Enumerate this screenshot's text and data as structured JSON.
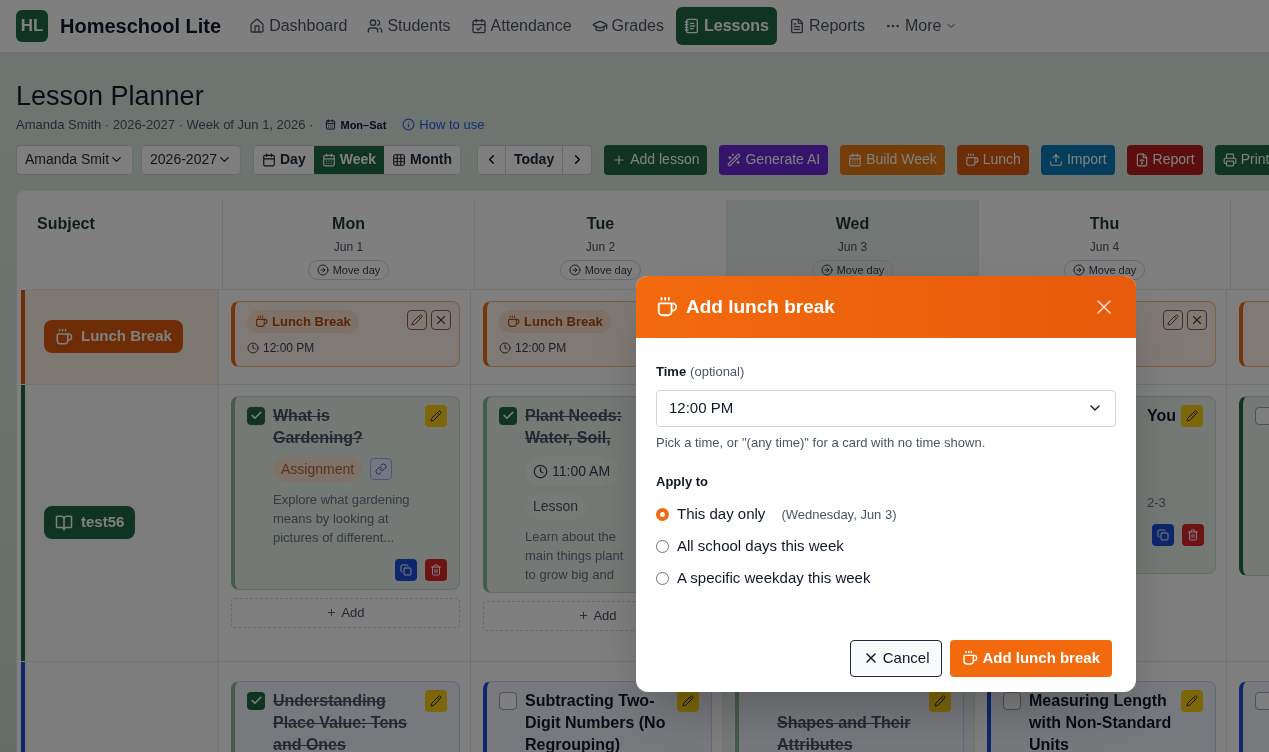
{
  "nav": {
    "logo": "HL",
    "brand": "Homeschool Lite",
    "items": [
      {
        "label": "Dashboard",
        "kind": "home",
        "selected": false
      },
      {
        "label": "Students",
        "kind": "people",
        "selected": false
      },
      {
        "label": "Attendance",
        "kind": "attendance",
        "selected": false
      },
      {
        "label": "Grades",
        "kind": "grades",
        "selected": false
      },
      {
        "label": "Lessons",
        "kind": "lessons",
        "selected": true
      },
      {
        "label": "Reports",
        "kind": "reports",
        "selected": false
      },
      {
        "label": "More",
        "kind": "menu",
        "selected": false
      }
    ]
  },
  "page": {
    "title": "Lesson Planner",
    "subtitle": "Amanda Smith · 2026-2027 · Week of Jun 1, 2026 ·",
    "range_badge": "Mon–Sat",
    "help_link": "How to use"
  },
  "toolbar": {
    "selects": [
      "Amanda Smit",
      "2026-2027"
    ],
    "views": [
      {
        "label": "Day",
        "selected": false
      },
      {
        "label": "Week",
        "selected": true
      },
      {
        "label": "Month",
        "selected": false
      }
    ],
    "today": "Today",
    "actions": [
      {
        "label": "Add lesson",
        "kind": "add"
      },
      {
        "label": "Generate AI",
        "kind": "ai"
      },
      {
        "label": "Build Week",
        "kind": "build"
      },
      {
        "label": "Lunch",
        "kind": "lunch"
      },
      {
        "label": "Import",
        "kind": "import"
      },
      {
        "label": "Report",
        "kind": "report"
      },
      {
        "label": "Print",
        "kind": "print"
      }
    ]
  },
  "planner": {
    "subject_heading": "Subject",
    "days": [
      {
        "day": "Mon",
        "date": "Jun 1",
        "move": "Move day",
        "selected": false
      },
      {
        "day": "Tue",
        "date": "Jun 2",
        "move": "Move day",
        "selected": false
      },
      {
        "day": "Wed",
        "date": "Jun 3",
        "move": "Move day",
        "selected": true
      },
      {
        "day": "Thu",
        "date": "Jun 4",
        "move": "Move day",
        "selected": false
      }
    ],
    "rows": [
      {
        "kind": "lunch",
        "label": "Lunch Break",
        "cells": [
          [
            {
              "kind": "lunch",
              "label": "Lunch Break",
              "time": "12:00 PM"
            }
          ],
          [
            {
              "kind": "lunch",
              "label": "Lunch Break",
              "time": "12:00 PM"
            }
          ],
          [],
          [
            {
              "kind": "lunch"
            }
          ],
          [
            {
              "kind": "lunch"
            }
          ]
        ]
      },
      {
        "kind": "green",
        "label": "test56",
        "cells": [
          [
            {
              "kind": "lesson",
              "done": true,
              "title": "What is Gardening?",
              "tag": "Assignment",
              "link": true,
              "description": "Explore what gardening means by looking at pictures of different...",
              "add": "Add"
            }
          ],
          [
            {
              "kind": "lessonright",
              "done": true,
              "title": "Plant Needs: Water, Soil,",
              "time": "11:00 AM",
              "tag": "Lesson",
              "description": "Learn about the main things plant to grow big and",
              "add": "Add"
            }
          ],
          [],
          [
            {
              "kind": "lessonleft",
              "title": "You",
              "description": "2-3"
            }
          ],
          [
            {
              "kind": "lesson",
              "done": false
            }
          ]
        ]
      },
      {
        "kind": "blue",
        "label": "",
        "cells": [
          [
            {
              "kind": "lesson",
              "done": true,
              "title": "Understanding Place Value: Tens and Ones"
            }
          ],
          [
            {
              "kind": "lesson",
              "done": false,
              "title": "Subtracting Two-Digit Numbers (No Regrouping)"
            }
          ],
          [
            {
              "kind": "lessonlow",
              "title": "Shapes and Their Attributes"
            }
          ],
          [
            {
              "kind": "lesson",
              "done": false,
              "title": "Measuring Length with Non-Standard Units"
            }
          ],
          [
            {
              "kind": "lesson",
              "done": false
            }
          ]
        ]
      }
    ]
  },
  "dialog": {
    "title": "Add lunch break",
    "time_label": "Time",
    "time_note": "(optional)",
    "time_value": "12:00 PM",
    "hint": "Pick a time, or \"(any time)\" for a card with no time shown.",
    "apply_label": "Apply to",
    "options": [
      {
        "label": "This day only",
        "note": "(Wednesday, Jun 3)",
        "selected": true
      },
      {
        "label": "All school days this week",
        "selected": false
      },
      {
        "label": "A specific weekday this week",
        "selected": false
      }
    ],
    "cancel": "Cancel",
    "submit": "Add lunch break"
  }
}
